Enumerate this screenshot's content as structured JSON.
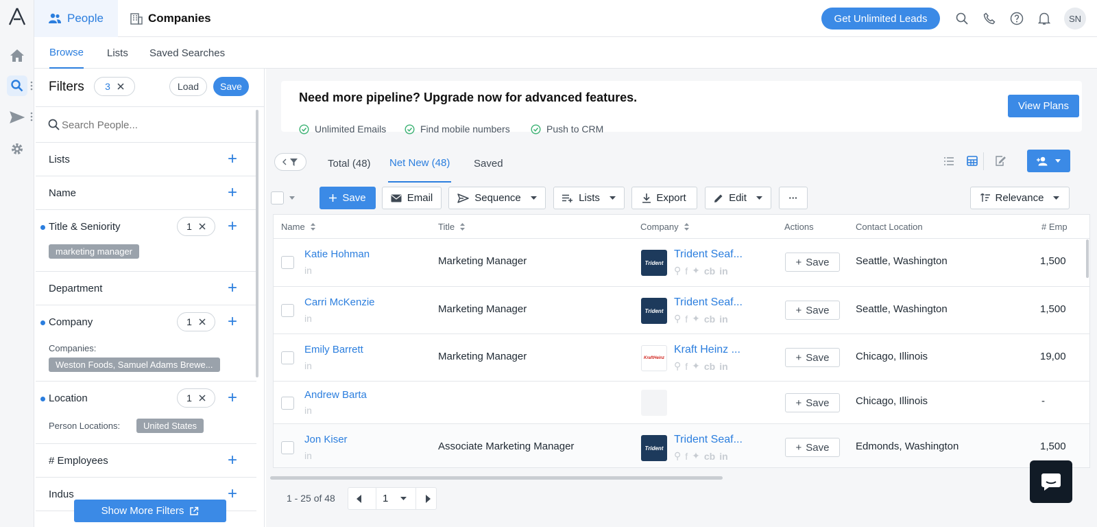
{
  "topbar": {
    "tab_people": "People",
    "tab_companies": "Companies",
    "unlimited_button": "Get Unlimited Leads",
    "avatar": "SN"
  },
  "subnav": {
    "browse": "Browse",
    "lists": "Lists",
    "saved_searches": "Saved Searches"
  },
  "filters": {
    "title": "Filters",
    "count": "3",
    "load": "Load",
    "save": "Save",
    "search_placeholder": "Search People...",
    "rows": {
      "lists": "Lists",
      "name": "Name",
      "title": "Title & Seniority",
      "title_count": "1",
      "title_chip": "marketing manager",
      "department": "Department",
      "company": "Company",
      "company_count": "1",
      "companies_label": "Companies:",
      "companies_chip": "Weston Foods, Samuel Adams Brewe...",
      "location": "Location",
      "location_count": "1",
      "person_locations_label": "Person Locations:",
      "location_chip": "United States",
      "employees": "# Employees",
      "industry": "Indus"
    },
    "show_more": "Show More Filters"
  },
  "banner": {
    "headline": "Need more pipeline? Upgrade now for advanced features.",
    "features": [
      "Unlimited Emails",
      "Find mobile numbers",
      "Push to CRM"
    ],
    "view_plans": "View Plans"
  },
  "results": {
    "total": "Total (48)",
    "net_new": "Net New (48)",
    "saved": "Saved"
  },
  "toolbar": {
    "save": "Save",
    "email": "Email",
    "sequence": "Sequence",
    "lists": "Lists",
    "export": "Export",
    "edit": "Edit",
    "more": "···",
    "sort": "Relevance"
  },
  "table": {
    "headers": {
      "name": "Name",
      "title": "Title",
      "company": "Company",
      "actions": "Actions",
      "location": "Contact Location",
      "employees": "# Emp"
    },
    "save_label": "Save",
    "rows": [
      {
        "name": "Katie Hohman",
        "title": "Marketing Manager",
        "company": "Trident Seaf...",
        "logo": "Trident",
        "location": "Seattle, Washington",
        "employees": "1,500"
      },
      {
        "name": "Carri McKenzie",
        "title": "Marketing Manager",
        "company": "Trident Seaf...",
        "logo": "Trident",
        "location": "Seattle, Washington",
        "employees": "1,500"
      },
      {
        "name": "Emily Barrett",
        "title": "Marketing Manager",
        "company": "Kraft Heinz ...",
        "logo": "KraftHeinz",
        "location": "Chicago, Illinois",
        "employees": "19,00"
      },
      {
        "name": "Andrew Barta",
        "title": "",
        "company": "",
        "logo": "",
        "location": "Chicago, Illinois",
        "employees": "-"
      },
      {
        "name": "Jon Kiser",
        "title": "Associate Marketing Manager",
        "company": "Trident Seaf...",
        "logo": "Trident",
        "location": "Edmonds, Washington",
        "employees": "1,500"
      }
    ]
  },
  "pager": {
    "range": "1 - 25 of 48",
    "page": "1"
  },
  "colors": {
    "accent": "#2b7ede",
    "button": "#3b8ae6",
    "trident_logo": "#1d3a5c"
  }
}
